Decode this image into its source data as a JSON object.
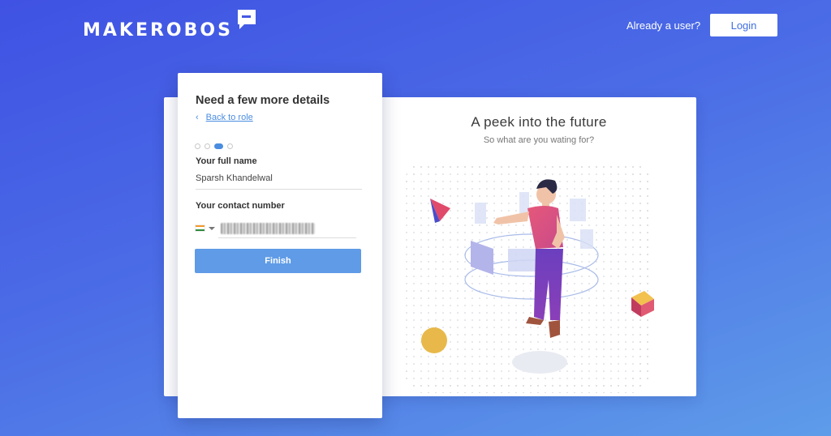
{
  "brand": {
    "name": "MAKEROBOS",
    "logo_icon": "speech-bubble-icon"
  },
  "header": {
    "already_user_text": "Already a user?",
    "login_label": "Login"
  },
  "form": {
    "title": "Need a few more details",
    "back_link_label": "Back to role",
    "steps": {
      "total": 4,
      "active": 3
    },
    "full_name_label": "Your full name",
    "full_name_value": "Sparsh Khandelwal",
    "contact_label": "Your contact number",
    "country_flag": "india-flag-icon",
    "finish_label": "Finish"
  },
  "promo": {
    "title": "A peek into the future",
    "subtitle": "So what are you wating for?"
  },
  "colors": {
    "background_start": "#3f52e3",
    "background_end": "#5e9ce9",
    "accent": "#5f9be6",
    "link": "#4a8de0"
  }
}
